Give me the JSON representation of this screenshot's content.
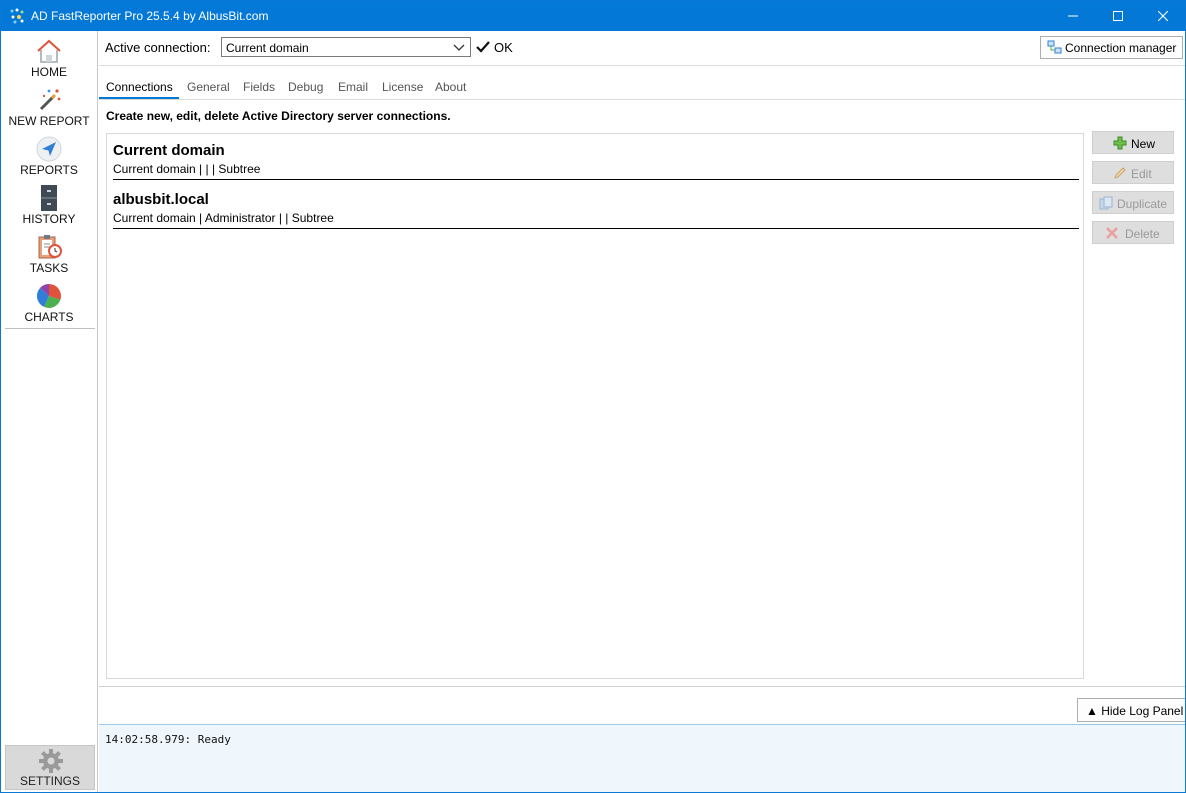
{
  "window": {
    "title": "AD FastReporter Pro 25.5.4 by AlbusBit.com"
  },
  "sidebar": {
    "items": [
      {
        "label": "HOME",
        "icon": "home-icon"
      },
      {
        "label": "NEW REPORT",
        "icon": "magic-wand-icon"
      },
      {
        "label": "REPORTS",
        "icon": "navigation-arrow-icon"
      },
      {
        "label": "HISTORY",
        "icon": "filing-cabinet-icon"
      },
      {
        "label": "TASKS",
        "icon": "clipboard-clock-icon"
      },
      {
        "label": "CHARTS",
        "icon": "pie-chart-icon"
      }
    ],
    "settings_label": "SETTINGS"
  },
  "connection": {
    "label": "Active connection:",
    "selected": "Current domain",
    "status": "OK",
    "manager_label": "Connection manager"
  },
  "tabs": [
    {
      "label": "Connections",
      "active": true
    },
    {
      "label": "General",
      "active": false
    },
    {
      "label": "Fields",
      "active": false
    },
    {
      "label": "Debug",
      "active": false
    },
    {
      "label": "Email",
      "active": false
    },
    {
      "label": "License",
      "active": false
    },
    {
      "label": "About",
      "active": false
    }
  ],
  "connections_page": {
    "description": "Create new, edit, delete Active Directory server connections.",
    "items": [
      {
        "name": "Current domain",
        "details": "Current domain |  |  | Subtree"
      },
      {
        "name": "albusbit.local",
        "details": "Current domain | Administrator |  | Subtree"
      }
    ],
    "buttons": {
      "new": "New",
      "edit": "Edit",
      "duplicate": "Duplicate",
      "delete": "Delete"
    }
  },
  "log": {
    "toggle_label": "▲ Hide Log Panel",
    "lines": [
      "14:02:58.979: Ready"
    ]
  },
  "colors": {
    "titlebar": "#0378d7",
    "accent": "#0378d7",
    "log_bg": "#eff7fc"
  }
}
